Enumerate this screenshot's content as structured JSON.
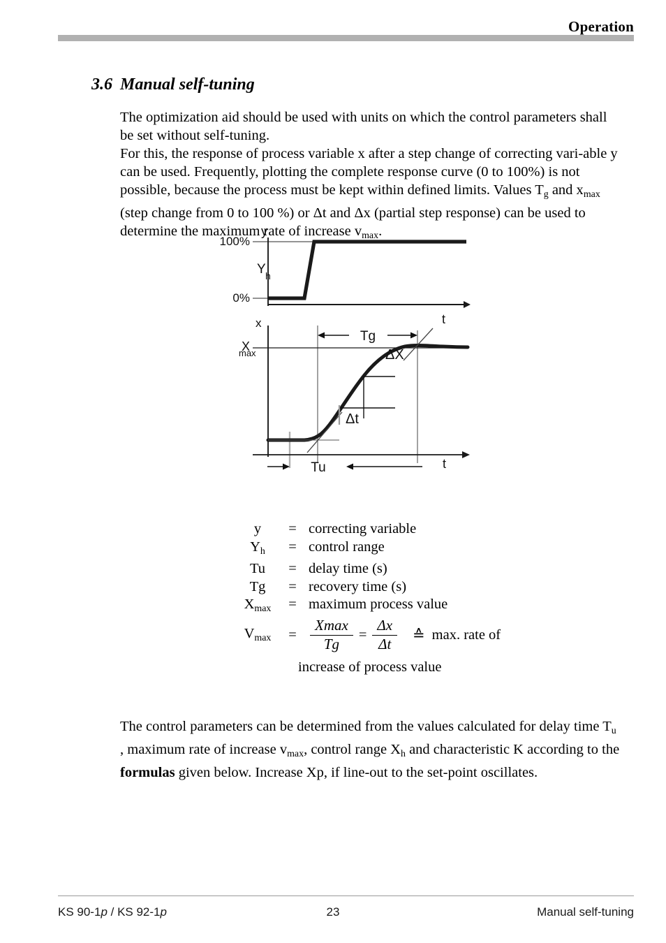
{
  "header": {
    "title": "Operation"
  },
  "section": {
    "number": "3.6",
    "title": "Manual self-tuning"
  },
  "paragraphs": {
    "p1_a": "The optimization aid should be used with units on which the control parameters shall be set without self-tuning.",
    "p2_line1": "For this, the response of process variable x after a step change of correcting vari-able y can be used. Frequently, plotting the complete response curve (0 to 100%) is not possible, because the process must  be kept within defined limits. Values T",
    "p2_sub1": "g",
    "p2_line2": " and x",
    "p2_sub2": "max",
    "p2_line3": " (step change from 0 to 100 %) or Δt and Δx (partial step response) can be used to determine the maximum rate of increase v",
    "p2_sub3": "max",
    "p2_line4": ".",
    "p3_line1": "The control parameters can be determined from the values calculated for delay time T",
    "p3_sub1": "u",
    "p3_line2": " , maximum rate of increase v",
    "p3_sub2": "max",
    "p3_line3": ", control range X",
    "p3_sub3": "h",
    "p3_line4": " and characteristic K according to the ",
    "p3_bold": "formulas",
    "p3_line5": " given below. Increase Xp, if line-out to the set-point oscillates."
  },
  "legend": {
    "rows": [
      {
        "symbol": "y",
        "sub": "",
        "eq": "=",
        "desc": "correcting variable"
      },
      {
        "symbol": "Y",
        "sub": "h",
        "eq": "=",
        "desc": "control range"
      },
      {
        "symbol": "Tu",
        "sub": "",
        "eq": "=",
        "desc": "delay time (s)"
      },
      {
        "symbol": "Tg",
        "sub": "",
        "eq": "=",
        "desc": "recovery time (s)"
      },
      {
        "symbol": "X",
        "sub": "max",
        "eq": "=",
        "desc": "maximum process value"
      }
    ]
  },
  "formula": {
    "lhs": "V",
    "lhs_sub": "max",
    "eq1": "=",
    "frac1_num": "Xmax",
    "frac1_den": "Tg",
    "eq2": "=",
    "frac2_num": "Δx",
    "frac2_den": "Δt",
    "corresponds": "≙",
    "tail": "max. rate of",
    "line2": "increase of process value"
  },
  "chart_data": {
    "type": "line",
    "title": "",
    "panels": [
      {
        "name": "correcting-variable-step",
        "ylabel": "y",
        "xlabel": "t",
        "ytick_labels": [
          "100%",
          "0%"
        ],
        "range_label": "Y",
        "range_label_sub": "h",
        "series": [
          {
            "name": "y step",
            "points": [
              [
                0,
                0
              ],
              [
                37,
                0
              ],
              [
                53,
                100
              ],
              [
                286,
                100
              ]
            ],
            "ylim": [
              0,
              100
            ]
          }
        ]
      },
      {
        "name": "process-variable-response",
        "ylabel": "x",
        "xlabel": "t",
        "ytick_labels": [
          "X"
        ],
        "ytick_sub": "max",
        "annotations": [
          "Tg",
          "Tu",
          "ΔX",
          "Δt"
        ],
        "series": [
          {
            "name": "x response",
            "points": [
              [
                0,
                0
              ],
              [
                40,
                0
              ],
              [
                60,
                2
              ],
              [
                80,
                8
              ],
              [
                100,
                20
              ],
              [
                125,
                38
              ],
              [
                150,
                58
              ],
              [
                175,
                76
              ],
              [
                200,
                89
              ],
              [
                225,
                96
              ],
              [
                250,
                99
              ],
              [
                286,
                100
              ]
            ],
            "ylim": [
              0,
              100
            ]
          }
        ]
      }
    ],
    "legend_position": "below"
  },
  "footer": {
    "left_pre": "KS 90-1",
    "left_italic1": "p",
    "left_mid": " / KS 92-1",
    "left_italic2": "p",
    "page": "23",
    "right": "Manual self-tuning"
  },
  "colors": {
    "rule": "#b1b1b1",
    "text": "#000000",
    "curve": "#1a1a1a",
    "thin_line": "#333333",
    "tick_gray": "#9a9a9a"
  }
}
